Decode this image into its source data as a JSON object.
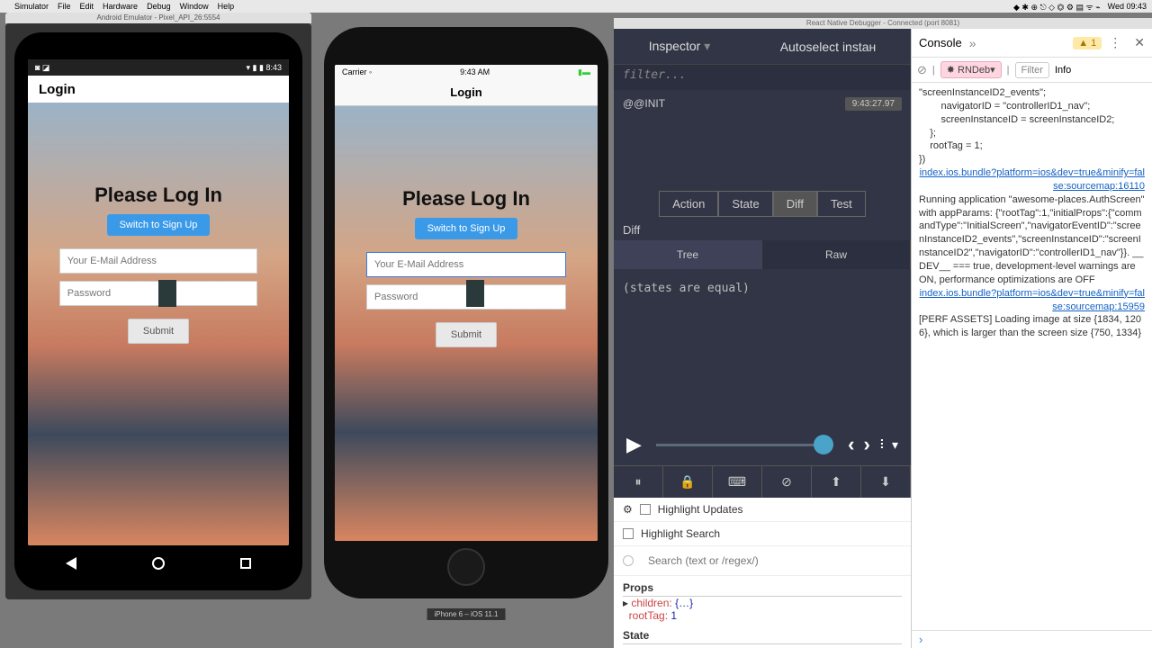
{
  "menubar": {
    "apple": "",
    "items": [
      "Simulator",
      "File",
      "Edit",
      "Hardware",
      "Debug",
      "Window",
      "Help"
    ],
    "clock": "Wed 09:43"
  },
  "android": {
    "window_title": "Android Emulator - Pixel_API_26:5554",
    "status_time": "8:43",
    "header": "Login"
  },
  "ios": {
    "carrier": "Carrier ◦",
    "time": "9:43 AM",
    "header": "Login",
    "device_label": "iPhone 6 – iOS 11.1"
  },
  "login": {
    "title": "Please Log In",
    "switch": "Switch to Sign Up",
    "email_ph": "Your E-Mail Address",
    "password_ph": "Password",
    "submit": "Submit"
  },
  "debugger": {
    "title": "React Native Debugger - Connected (port 8081)",
    "top_tab1": "Inspector",
    "top_tab2": "Autoselect instан",
    "filter_ph": "filter...",
    "init_action": "@@INIT",
    "init_ts": "9:43:27.97",
    "tabs": [
      "Action",
      "State",
      "Diff",
      "Test"
    ],
    "tabs_active": "Diff",
    "section_label": "Diff",
    "subtabs": [
      "Tree",
      "Raw"
    ],
    "subtab_active": "Tree",
    "states_equal": "(states are equal)",
    "inspector": {
      "highlight_updates": "Highlight Updates",
      "highlight_search": "Highlight Search",
      "search_ph": "Search (text or /regex/)",
      "props_hdr": "Props",
      "children_k": "children:",
      "children_v": "{…}",
      "root_k": "rootTag:",
      "root_v": "1",
      "state_hdr": "State"
    }
  },
  "console": {
    "tab": "Console",
    "warn_count": "1",
    "context_btn": "RNDeb▾",
    "filter": "Filter",
    "info": "Info",
    "log1": "\"screenInstanceID2_events\";\n        navigatorID = \"controllerID1_nav\";\n        screenInstanceID = screenInstanceID2;\n    };\n    rootTag = 1;\n})",
    "link1": "index.ios.bundle?platform=ios&dev=true&minify=false:sourcemap:16110",
    "log2": "Running application \"awesome-places.AuthScreen\" with appParams: {\"rootTag\":1,\"initialProps\":{\"commandType\":\"InitialScreen\",\"navigatorEventID\":\"screenInstanceID2_events\",\"screenInstanceID\":\"screenInstanceID2\",\"navigatorID\":\"controllerID1_nav\"}}. __DEV__ === true, development-level warnings are ON, performance optimizations are OFF",
    "link2": "index.ios.bundle?platform=ios&dev=true&minify=false:sourcemap:15959",
    "log3": "[PERF ASSETS] Loading image at size {1834, 1206}, which is larger than the screen size {750, 1334}"
  }
}
